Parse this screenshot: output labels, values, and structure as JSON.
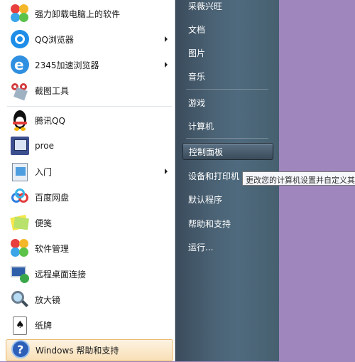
{
  "programs": [
    {
      "label": "强力卸载电脑上的软件",
      "icon": "petal-logo-icon",
      "has_submenu": false
    },
    {
      "label": "QQ浏览器",
      "icon": "qq-browser-icon",
      "has_submenu": true
    },
    {
      "label": "2345加速浏览器",
      "icon": "ie-browser-icon",
      "has_submenu": true
    },
    {
      "label": "截图工具",
      "icon": "snipping-tool-icon",
      "has_submenu": false
    },
    {
      "label": "腾讯QQ",
      "icon": "qq-penguin-icon",
      "has_submenu": false
    },
    {
      "label": "proe",
      "icon": "proe-icon",
      "has_submenu": false
    },
    {
      "label": "入门",
      "icon": "getting-started-icon",
      "has_submenu": true
    },
    {
      "label": "百度网盘",
      "icon": "baidu-netdisk-icon",
      "has_submenu": false
    },
    {
      "label": "便笺",
      "icon": "sticky-notes-icon",
      "has_submenu": false
    },
    {
      "label": "软件管理",
      "icon": "software-manager-icon",
      "has_submenu": false
    },
    {
      "label": "远程桌面连接",
      "icon": "remote-desktop-icon",
      "has_submenu": false
    },
    {
      "label": "放大镜",
      "icon": "magnifier-icon",
      "has_submenu": false
    },
    {
      "label": "纸牌",
      "icon": "solitaire-icon",
      "has_submenu": false
    },
    {
      "label": "Windows 帮助和支持",
      "icon": "help-icon",
      "has_submenu": false
    }
  ],
  "places": [
    {
      "label": "采薇兴旺"
    },
    {
      "label": "文档"
    },
    {
      "label": "图片"
    },
    {
      "label": "音乐"
    },
    {
      "label": "游戏"
    },
    {
      "label": "计算机"
    },
    {
      "label": "控制面板"
    },
    {
      "label": "设备和打印机"
    },
    {
      "label": "默认程序"
    },
    {
      "label": "帮助和支持"
    },
    {
      "label": "运行..."
    }
  ],
  "tooltip": {
    "text": "更改您的计算机设置并自定义其"
  },
  "colors": {
    "desktop": "#9f86bd",
    "right_pane": "#4a6274",
    "highlight": "#f8dfb6"
  }
}
